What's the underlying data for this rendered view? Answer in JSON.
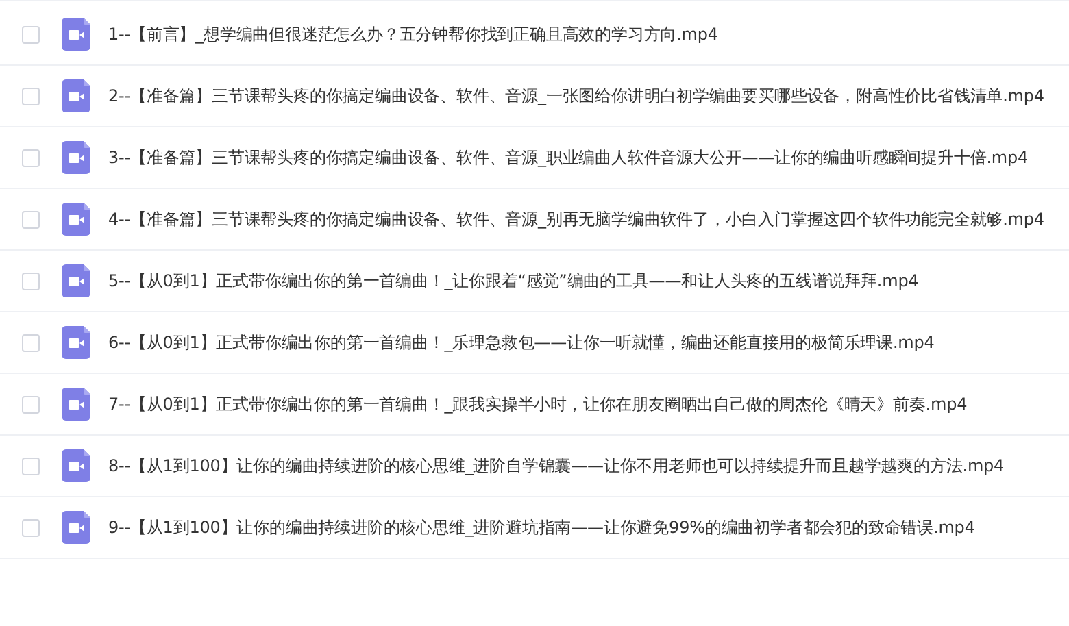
{
  "files": [
    {
      "name": "1--【前言】_想学编曲但很迷茫怎么办？五分钟帮你找到正确且高效的学习方向.mp4",
      "checked": false
    },
    {
      "name": "2--【准备篇】三节课帮头疼的你搞定编曲设备、软件、音源_一张图给你讲明白初学编曲要买哪些设备，附高性价比省钱清单.mp4",
      "checked": false
    },
    {
      "name": "3--【准备篇】三节课帮头疼的你搞定编曲设备、软件、音源_职业编曲人软件音源大公开——让你的编曲听感瞬间提升十倍.mp4",
      "checked": false
    },
    {
      "name": "4--【准备篇】三节课帮头疼的你搞定编曲设备、软件、音源_别再无脑学编曲软件了，小白入门掌握这四个软件功能完全就够.mp4",
      "checked": false
    },
    {
      "name": "5--【从0到1】正式带你编出你的第一首编曲！_让你跟着“感觉”编曲的工具——和让人头疼的五线谱说拜拜.mp4",
      "checked": false
    },
    {
      "name": "6--【从0到1】正式带你编出你的第一首编曲！_乐理急救包——让你一听就懂，编曲还能直接用的极简乐理课.mp4",
      "checked": false
    },
    {
      "name": "7--【从0到1】正式带你编出你的第一首编曲！_跟我实操半小时，让你在朋友圈晒出自己做的周杰伦《晴天》前奏.mp4",
      "checked": false
    },
    {
      "name": "8--【从1到100】让你的编曲持续进阶的核心思维_进阶自学锦囊——让你不用老师也可以持续提升而且越学越爽的方法.mp4",
      "checked": false
    },
    {
      "name": "9--【从1到100】让你的编曲持续进阶的核心思维_进阶避坑指南——让你避免99%的编曲初学者都会犯的致命错误.mp4",
      "checked": false
    }
  ]
}
